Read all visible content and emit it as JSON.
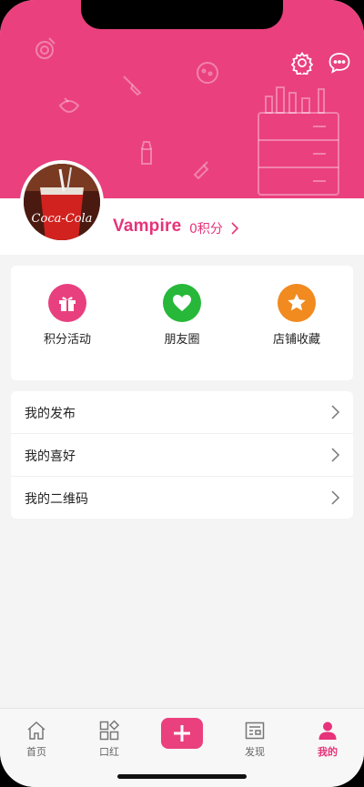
{
  "profile": {
    "username": "Vampire",
    "points": "0积分"
  },
  "features": [
    {
      "label": "积分活动",
      "icon": "gift-icon",
      "color": "#e8407f"
    },
    {
      "label": "朋友圈",
      "icon": "heart-icon",
      "color": "#27b839"
    },
    {
      "label": "店铺收藏",
      "icon": "star-icon",
      "color": "#f18a1f"
    }
  ],
  "menu": [
    {
      "label": "我的发布"
    },
    {
      "label": "我的喜好"
    },
    {
      "label": "我的二维码"
    }
  ],
  "tabbar": {
    "items": [
      {
        "label": "首页",
        "icon": "home-icon"
      },
      {
        "label": "口红",
        "icon": "grid-icon"
      },
      {
        "label": "",
        "icon": "plus-icon"
      },
      {
        "label": "发现",
        "icon": "news-icon"
      },
      {
        "label": "我的",
        "icon": "person-icon"
      }
    ]
  },
  "colors": {
    "brand": "#ea407e",
    "brand_text": "#e6337a"
  }
}
